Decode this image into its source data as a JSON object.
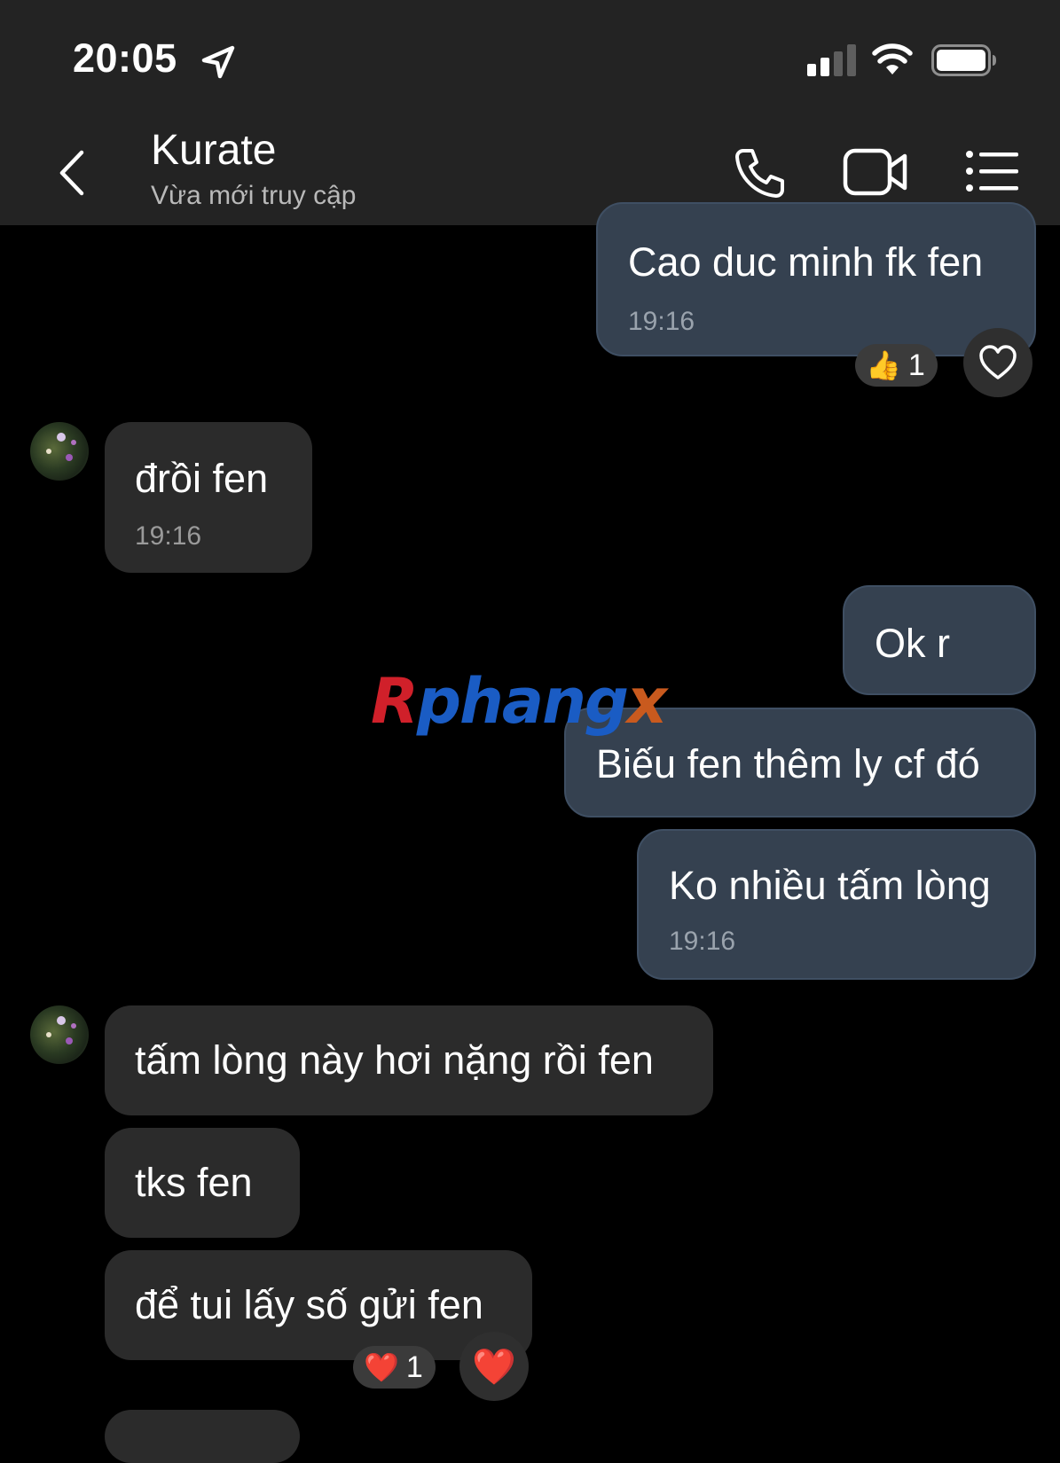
{
  "status_bar": {
    "time": "20:05"
  },
  "header": {
    "contact_name": "Kurate",
    "contact_status": "Vừa mới truy cập"
  },
  "messages": [
    {
      "id": "m1",
      "direction": "outgoing",
      "text": "Cao duc minh fk fen",
      "time": "19:16",
      "reaction": {
        "emoji": "👍",
        "count": "1"
      }
    },
    {
      "id": "m2",
      "direction": "incoming",
      "text": "đrồi fen",
      "time": "19:16"
    },
    {
      "id": "m3",
      "direction": "outgoing",
      "text": "Ok r"
    },
    {
      "id": "m4",
      "direction": "outgoing",
      "text": "Biếu fen thêm ly cf đó"
    },
    {
      "id": "m5",
      "direction": "outgoing",
      "text": "Ko nhiều tấm lòng",
      "time": "19:16"
    },
    {
      "id": "m6",
      "direction": "incoming",
      "text": "tấm lòng này hơi nặng rồi fen"
    },
    {
      "id": "m7",
      "direction": "incoming",
      "text": "tks fen"
    },
    {
      "id": "m8",
      "direction": "incoming",
      "text": "để tui lấy số gửi fen",
      "reaction": {
        "emoji": "❤️",
        "count": "1"
      },
      "quick_reaction": "❤️"
    }
  ],
  "watermark": {
    "text_r": "R",
    "text_mid": "phang",
    "text_x": "x"
  },
  "colors": {
    "outgoing_bubble": "#354150",
    "incoming_bubble": "#2b2b2b",
    "background": "#000000",
    "header": "#232323"
  }
}
